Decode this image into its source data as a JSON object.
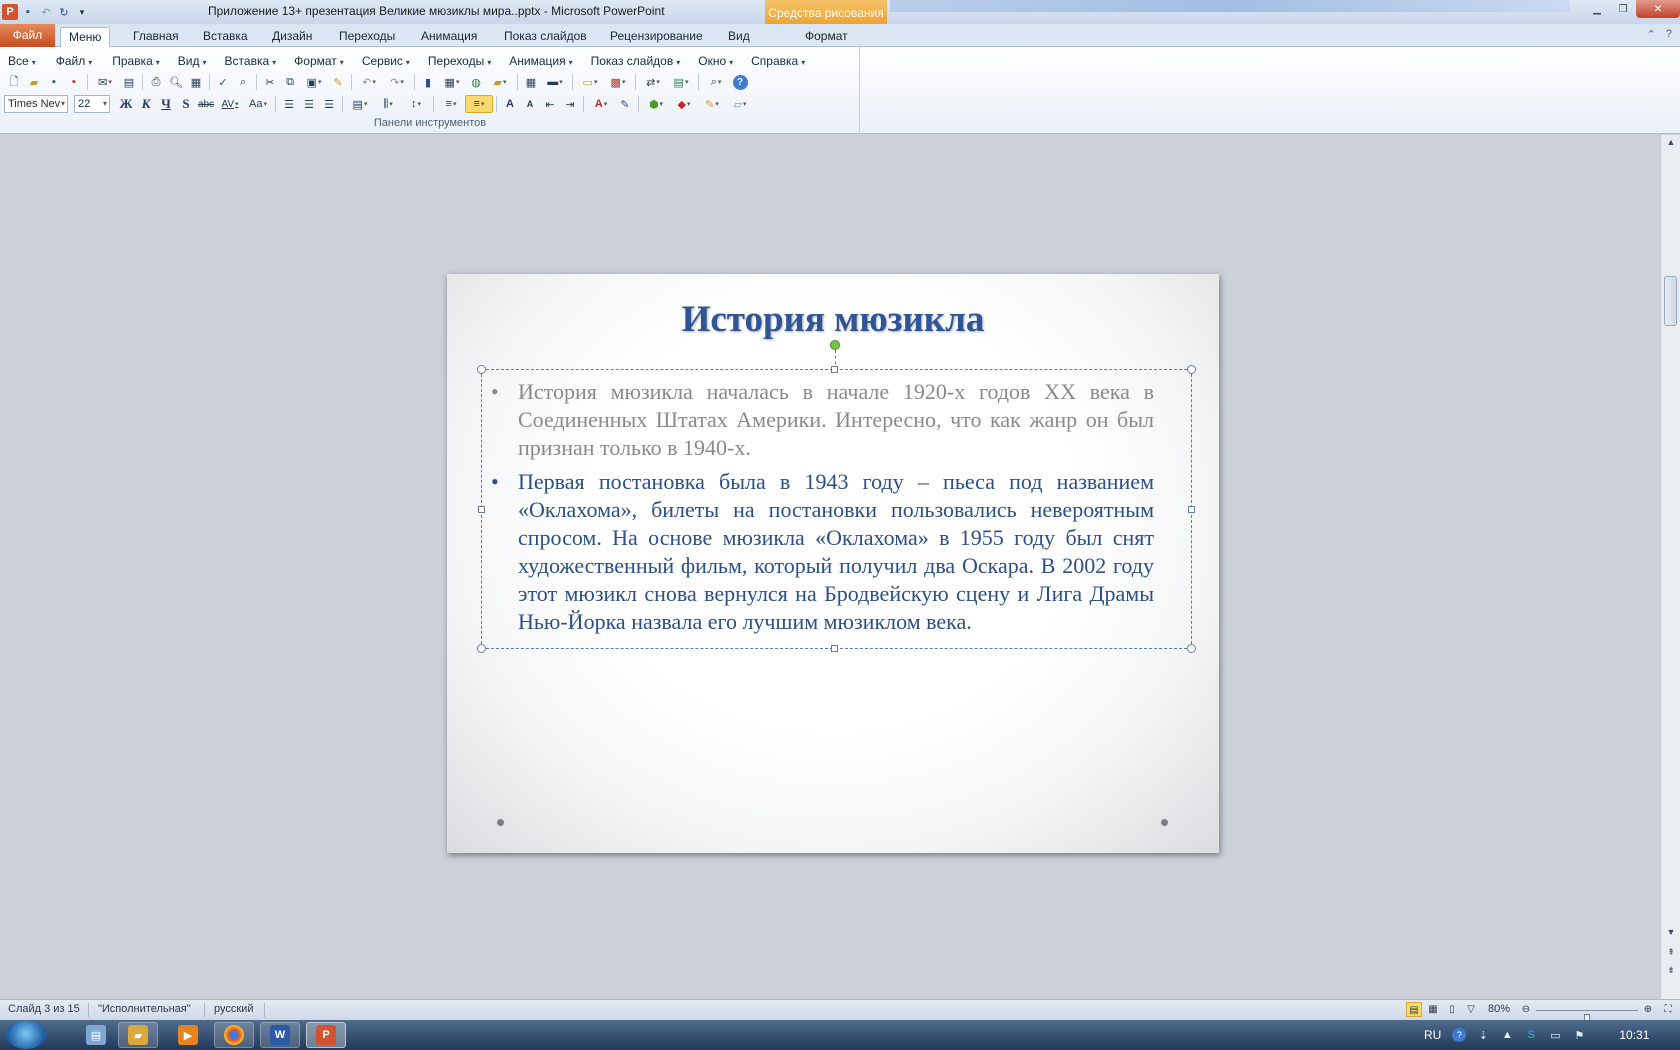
{
  "window": {
    "title": "Приложение  13+ презентация Великие мюзиклы мира..pptx  -  Microsoft PowerPoint",
    "contextual_header": "Средства рисования"
  },
  "ribbon": {
    "tabs": [
      "Файл",
      "Меню",
      "Главная",
      "Вставка",
      "Дизайн",
      "Переходы",
      "Анимация",
      "Показ слайдов",
      "Рецензирование",
      "Вид",
      "Формат"
    ],
    "active_tab": "Меню",
    "menus": [
      "Все",
      "Файл",
      "Правка",
      "Вид",
      "Вставка",
      "Формат",
      "Сервис",
      "Переходы",
      "Анимация",
      "Показ слайдов",
      "Окно",
      "Справка"
    ],
    "font_name": "Times Nev",
    "font_size": "22",
    "bold_label": "Ж",
    "italic_label": "К",
    "underline_label": "Ч",
    "shadow_label": "S",
    "strike_label": "abc",
    "spacing_label": "AV",
    "case_label": "Аа",
    "group_label": "Панели инструментов"
  },
  "slide": {
    "title": "История мюзикла",
    "bullets": [
      "История мюзикла началась в начале 1920-х годов XX века в Соединенных Штатах Америки. Интересно, что как жанр он был признан только в 1940-х.",
      "Первая постановка была в 1943 году – пьеса под названием «Оклахома», билеты на постановки пользовались невероятным спросом. На основе мюзикла «Оклахома» в 1955 году был снят художественный фильм, который получил два Оскара. В 2002 году этот мюзикл снова вернулся на Бродвейскую сцену и Лига Драмы Нью-Йорка назвала его лучшим мюзиклом века."
    ],
    "title_color": "#2f5597",
    "bullet1_color": "#8a8a8a",
    "bullet2_color": "#2c4f86"
  },
  "statusbar": {
    "slide_info": "Слайд 3 из 15",
    "theme": "\"Исполнительная\"",
    "language": "русский",
    "zoom": "80%",
    "zoom_fraction": 0.5
  },
  "taskbar": {
    "lang": "RU",
    "time": "10:31",
    "apps": [
      "Notepad",
      "Explorer",
      "Media",
      "Chrome",
      "Word",
      "PowerPoint"
    ]
  }
}
